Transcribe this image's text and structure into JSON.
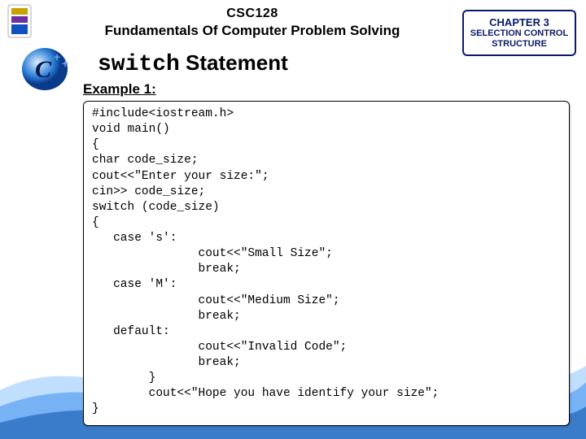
{
  "header": {
    "course_code": "CSC128",
    "course_title": "Fundamentals Of Computer Problem Solving"
  },
  "chapter": {
    "line1": "CHAPTER 3",
    "line2": "SELECTION CONTROL",
    "line3": "STRUCTURE"
  },
  "section": {
    "switch_word": "switch",
    "statement_word": " Statement"
  },
  "example_label": "Example 1:",
  "code": "#include<iostream.h>\nvoid main()\n{\nchar code_size;\ncout<<\"Enter your size:\";\ncin>> code_size;\nswitch (code_size)\n{\n   case 's':\n               cout<<\"Small Size\";\n               break;\n   case 'M':\n               cout<<\"Medium Size\";\n               break;\n   default:\n               cout<<\"Invalid Code\";\n               break;\n        }\n        cout<<\"Hope you have identify your size\";\n}"
}
